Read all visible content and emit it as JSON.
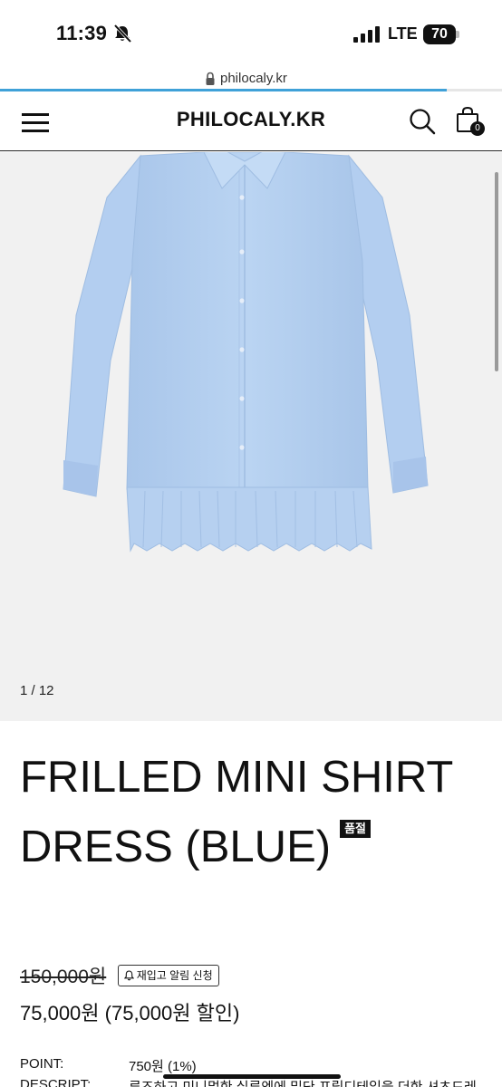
{
  "status_bar": {
    "time": "11:39",
    "network": "LTE",
    "battery": "70",
    "icons": [
      "bell-slash-icon",
      "signal-icon"
    ]
  },
  "browser": {
    "url": "philocaly.kr",
    "load_progress": 0.89
  },
  "header": {
    "logo": "PHILOCALY.KR",
    "cart_count": "0",
    "icons": [
      "menu-icon",
      "search-icon",
      "shopping-bag-icon"
    ]
  },
  "gallery": {
    "counter": "1 / 12",
    "image": "light-blue-frilled-shirt-dress"
  },
  "product": {
    "title": "FRILLED MINI SHIRT DRESS (BLUE)",
    "soldout_badge": "품절",
    "original_price": "150,000원",
    "restock_button": "재입고 알림 신청",
    "sale_price": "75,000원 (75,000원 할인)",
    "point_label": "POINT:",
    "point_value": "750원 (1%)",
    "description_label": "DESCRIPT:",
    "description_value": "루즈하고 미니멀한 실루엣에 밑단 프릴디테일을 더한 셔츠드레"
  },
  "colors": {
    "accent": "#3fa1d8",
    "shirt": "#b9d3f1",
    "gallery_bg": "#f1f1f1"
  }
}
